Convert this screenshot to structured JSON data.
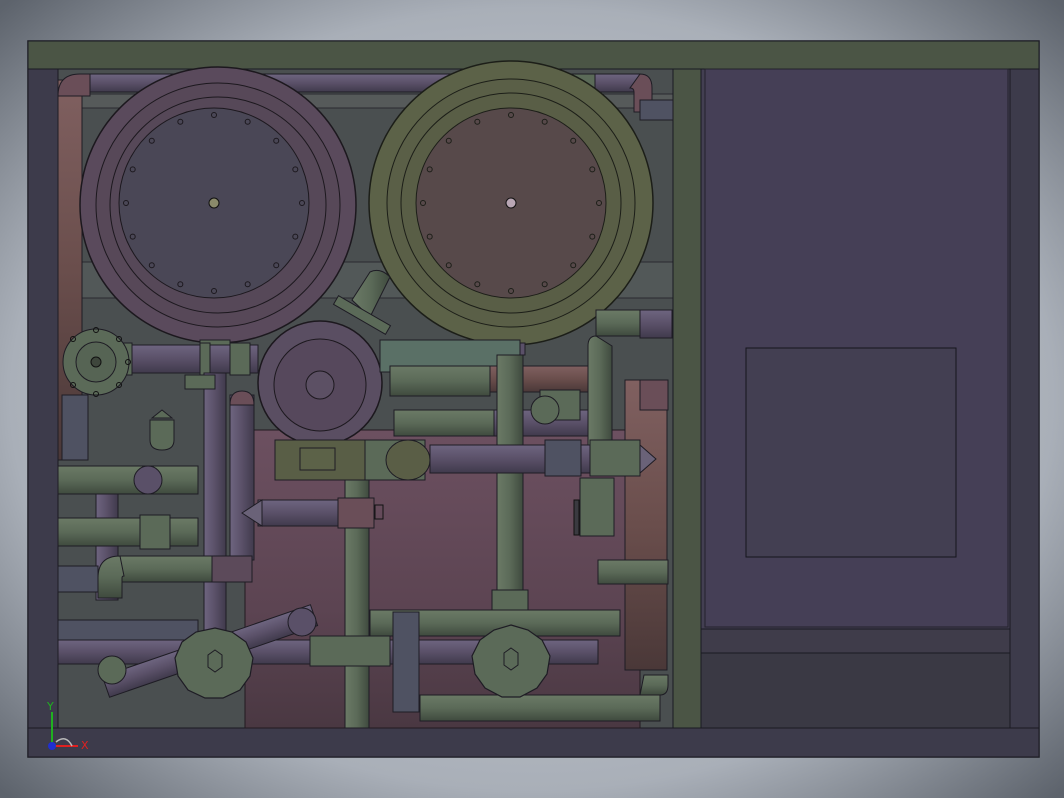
{
  "triad": {
    "x_label": "X",
    "y_label": "Y",
    "x_color": "#e02020",
    "y_color": "#20b020",
    "z_color": "#2030d0"
  },
  "palette": {
    "frame": "#3e3c4c",
    "frame_top": "#4b5545",
    "interior": "#4a4f50",
    "tank_purple": "#5a4a5c",
    "tank_olive": "#5c6248",
    "pipe_green": "#5b6a58",
    "pipe_purple": "#5a5068",
    "pipe_brown": "#6a4e4c",
    "panel": "#433f52",
    "base_tank": "#5c4452"
  },
  "icons": [
    "coordinate-triad-icon",
    "valve-handwheel-icon"
  ]
}
